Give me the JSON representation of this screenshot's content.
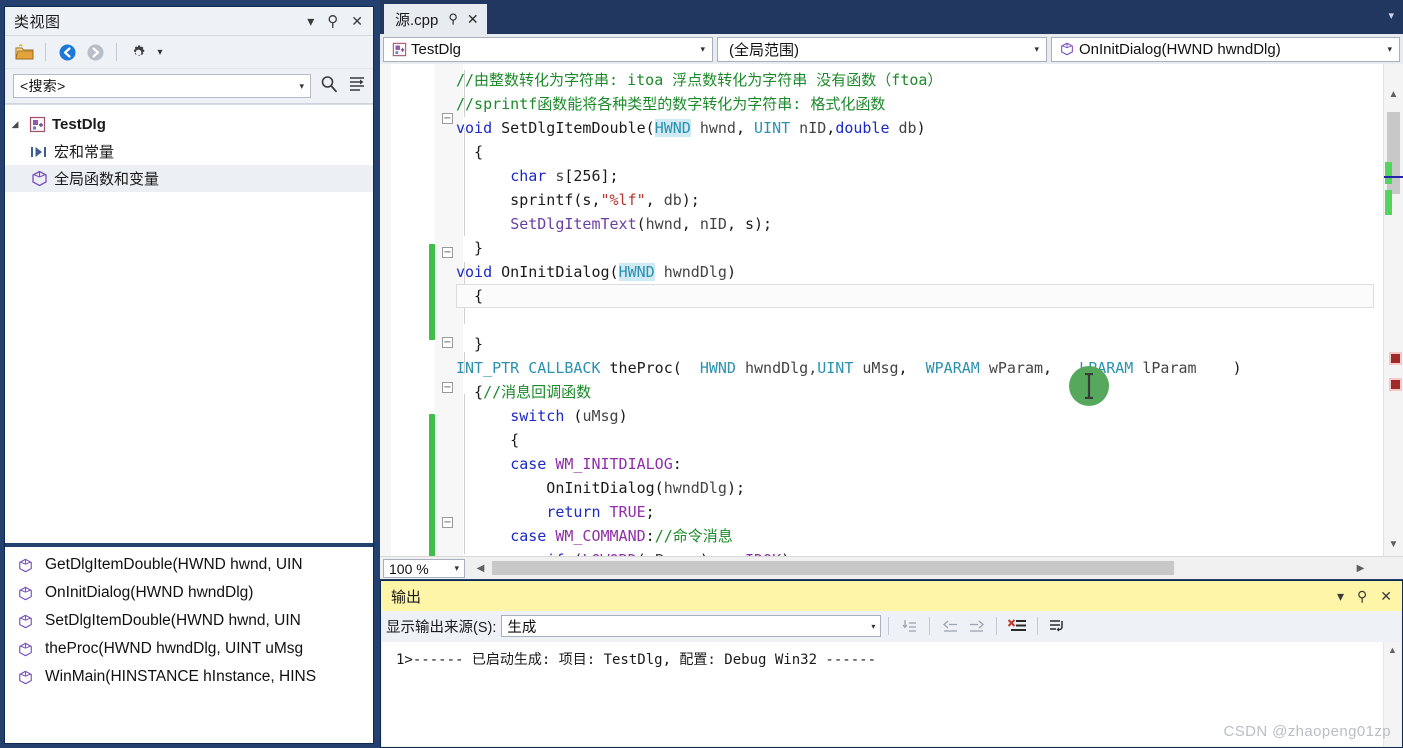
{
  "classview": {
    "title": "类视图",
    "title_controls": [
      "chevron-down-icon",
      "pin-icon",
      "close-icon"
    ],
    "toolbar": [
      "new-folder-icon",
      "back-icon",
      "forward-icon",
      "gear-icon",
      "dropdown-caret-icon"
    ],
    "search": {
      "value": "<搜索>",
      "dropdown_caret": "▾",
      "search_icon": "search-icon",
      "filter_icon": "sort-filter-icon"
    },
    "tree": [
      {
        "label": "TestDlg",
        "icon": "project-icon",
        "expander": "▲",
        "level": 0
      },
      {
        "label": "宏和常量",
        "icon": "macro-icon",
        "level": 1
      },
      {
        "label": "全局函数和变量",
        "icon": "globals-icon",
        "level": 1,
        "selected": true
      }
    ],
    "members": [
      {
        "icon": "method-icon",
        "label": "GetDlgItemDouble(HWND hwnd, UIN"
      },
      {
        "icon": "method-icon",
        "label": "OnInitDialog(HWND hwndDlg)"
      },
      {
        "icon": "method-icon",
        "label": "SetDlgItemDouble(HWND hwnd, UIN"
      },
      {
        "icon": "method-icon",
        "label": "theProc(HWND hwndDlg, UINT uMsg"
      },
      {
        "icon": "method-icon",
        "label": "WinMain(HINSTANCE hInstance, HINS"
      }
    ]
  },
  "editor": {
    "tab": {
      "name": "源.cpp",
      "pin": "pin-icon",
      "close": "close-icon"
    },
    "tabstrip_caret": "▾",
    "navbar": {
      "project": {
        "label": "TestDlg",
        "icon": "project-icon",
        "caret": "▾"
      },
      "scope": {
        "label": "(全局范围)",
        "caret": "▾"
      },
      "member": {
        "label": "OnInitDialog(HWND hwndDlg)",
        "icon": "method-icon",
        "caret": "▾"
      }
    },
    "zoom_level": "100 %",
    "zoom_caret": "▾",
    "code_lines": [
      "//由整数转化为字符串: itoa 浮点数转化为字符串 没有函数（ftoa）",
      "//sprintf函数能将各种类型的数字转化为字符串: 格式化函数",
      "void SetDlgItemDouble(HWND hwnd, UINT nID,double db)",
      "{",
      "    char s[256];",
      "    sprintf(s,\"%lf\", db);",
      "    SetDlgItemText(hwnd, nID, s);",
      "}",
      "void OnInitDialog(HWND hwndDlg)",
      "{",
      "",
      "}",
      "INT_PTR CALLBACK theProc(  HWND hwndDlg,UINT uMsg,  WPARAM wParam,   LPARAM lParam    )",
      "{//消息回调函数",
      "    switch (uMsg)",
      "    {",
      "    case WM_INITDIALOG:",
      "        OnInitDialog(hwndDlg);",
      "        return TRUE;",
      "    case WM_COMMAND://命令消息",
      "        if (LOWORD(wParam) == IDOK)",
      "        {"
    ]
  },
  "output": {
    "title": "输出",
    "title_controls": [
      "chevron-down-icon",
      "pin-icon",
      "close-icon"
    ],
    "source_label": "显示输出来源(S):",
    "source_value": "生成",
    "source_caret": "▾",
    "toolbar_icons": [
      "jump-to-icon",
      "previous-message-icon",
      "next-message-icon",
      "clear-all-icon",
      "toggle-wordwrap-icon"
    ],
    "lines": [
      "1>------ 已启动生成: 项目: TestDlg, 配置: Debug Win32 ------"
    ],
    "scroll_up": "▲"
  },
  "watermark": "CSDN @zhaopeng01zp",
  "colors": {
    "shell_blue": "#24406e",
    "comment_green": "#1c8a2a",
    "keyword_blue": "#1b29c8",
    "type_teal": "#2b91af",
    "macro_purple": "#8f2fa8",
    "function_purple": "#6a3fa0",
    "string_red": "#b8342a",
    "output_title_yellow": "#fff5a8",
    "changebar_green": "#3fbf4a",
    "cursor_green": "#55a85c",
    "error_marker_red": "#9e2a2a"
  }
}
